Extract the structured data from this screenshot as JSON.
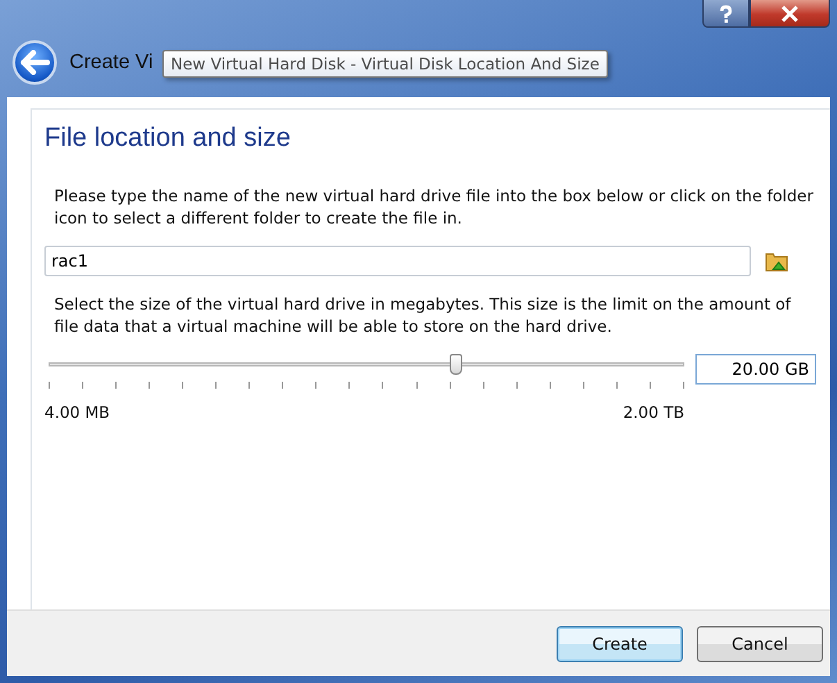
{
  "window": {
    "title": "Create Vi",
    "tooltip": "New Virtual Hard Disk - Virtual Disk Location And Size"
  },
  "page": {
    "heading": "File location and size",
    "location_hint": "Please type the name of the new virtual hard drive file into the box below or click on the folder icon to select a different folder to create the file in.",
    "file_name": "rac1",
    "size_hint": "Select the size of the virtual hard drive in megabytes. This size is the limit on the amount of file data that a virtual machine will be able to store on the hard drive.",
    "size": {
      "level": 0.64,
      "value": "20.00 GB",
      "min_label": "4.00 MB",
      "max_label": "2.00 TB"
    }
  },
  "buttons": [
    {
      "label": "Create",
      "default": true
    },
    {
      "label": "Cancel",
      "default": false
    }
  ]
}
